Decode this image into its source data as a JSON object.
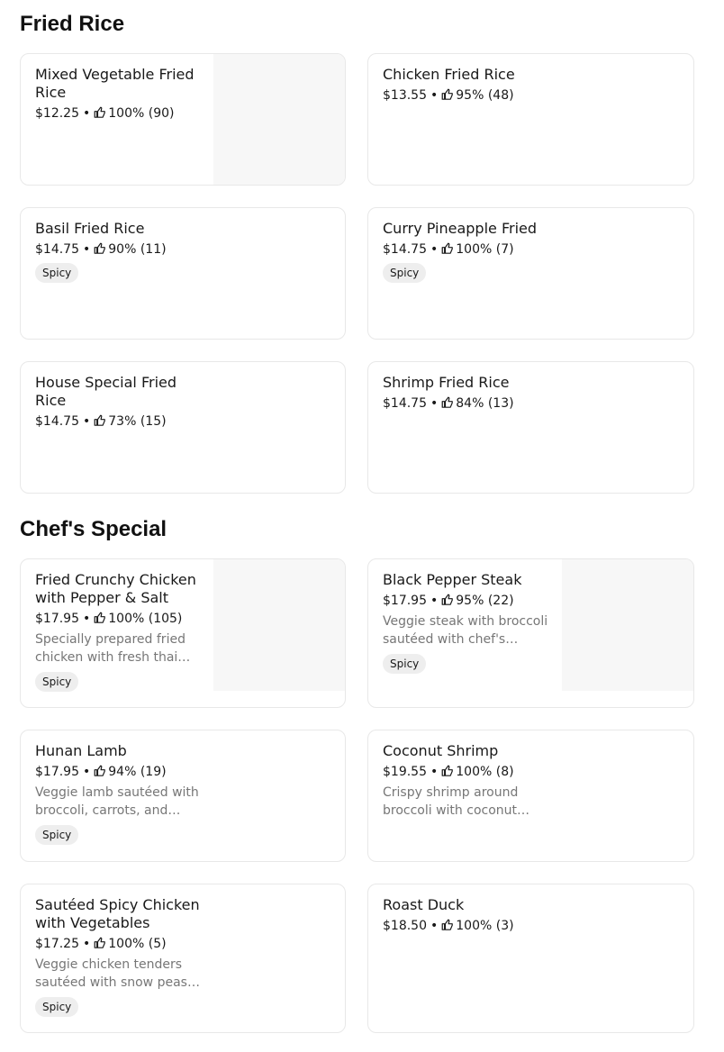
{
  "sections": [
    {
      "title": "Fried Rice",
      "items": [
        {
          "name": "Mixed Vegetable Fried Rice",
          "price": "$12.25",
          "rating": "100% (90)"
        },
        {
          "name": "Chicken Fried Rice",
          "price": "$13.55",
          "rating": "95% (48)"
        },
        {
          "name": "Basil Fried Rice",
          "price": "$14.75",
          "rating": "90% (11)",
          "badge": "Spicy"
        },
        {
          "name": "Curry Pineapple Fried",
          "price": "$14.75",
          "rating": "100% (7)",
          "badge": "Spicy"
        },
        {
          "name": "House Special Fried Rice",
          "price": "$14.75",
          "rating": "73% (15)"
        },
        {
          "name": "Shrimp Fried Rice",
          "price": "$14.75",
          "rating": "84% (13)"
        }
      ]
    },
    {
      "title": "Chef's Special",
      "items": [
        {
          "name": "Fried Crunchy Chicken with Pepper & Salt",
          "price": "$17.95",
          "rating": "100% (105)",
          "desc": "Specially prepared fried chicken with fresh thai…",
          "badge": "Spicy"
        },
        {
          "name": "Black Pepper Steak",
          "price": "$17.95",
          "rating": "95% (22)",
          "desc": "Veggie steak with broccoli sautéed with chef's…",
          "badge": "Spicy"
        },
        {
          "name": "Hunan Lamb",
          "price": "$17.95",
          "rating": "94% (19)",
          "desc": "Veggie lamb sautéed with broccoli, carrots, and…",
          "badge": "Spicy"
        },
        {
          "name": "Coconut Shrimp",
          "price": "$19.55",
          "rating": "100% (8)",
          "desc": "Crispy shrimp around broccoli with coconut…"
        },
        {
          "name": "Sautéed Spicy Chicken with Vegetables",
          "price": "$17.25",
          "rating": "100% (5)",
          "desc": "Veggie chicken tenders sautéed with snow peas…",
          "badge": "Spicy"
        },
        {
          "name": "Roast Duck",
          "price": "$18.50",
          "rating": "100% (3)"
        }
      ]
    }
  ],
  "separator": "•",
  "icons": {
    "rating": "thumbs-up-icon"
  },
  "colors": {
    "text": "#191919",
    "muted": "#767676",
    "badge_bg": "#eeeeee",
    "border": "#e8e8e8",
    "image_placeholder": "#f7f7f7"
  }
}
